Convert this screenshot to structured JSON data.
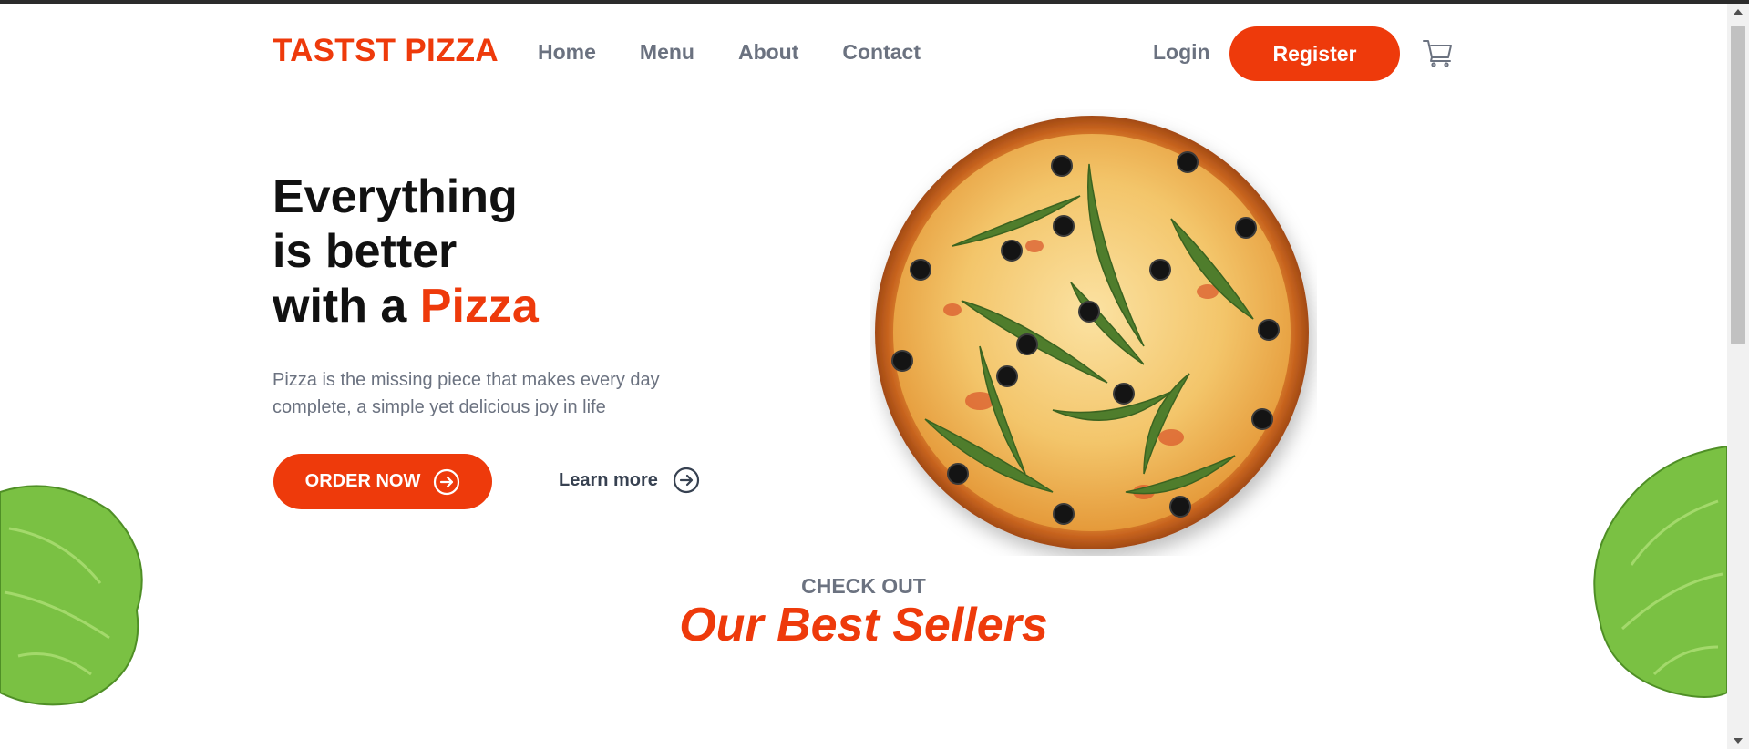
{
  "brand": {
    "logo": "TASTST PIZZA",
    "accent_color": "#ee3a0b"
  },
  "nav": {
    "links": [
      "Home",
      "Menu",
      "About",
      "Contact"
    ],
    "login": "Login",
    "register": "Register",
    "cart_icon": "cart-icon"
  },
  "hero": {
    "title_line1": "Everything",
    "title_line2": "is better",
    "title_line3_prefix": "with a ",
    "title_line3_accent": "Pizza",
    "description": "Pizza is the missing piece that makes every day complete, a simple yet delicious joy in life",
    "order_button": "ORDER NOW",
    "learn_more": "Learn more"
  },
  "best_sellers": {
    "kicker": "CHECK OUT",
    "title": "Our Best Sellers"
  }
}
